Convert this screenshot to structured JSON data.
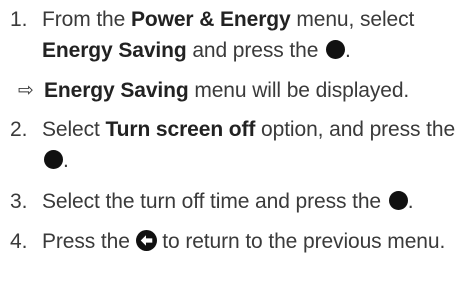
{
  "steps": [
    {
      "number": "1.",
      "parts": [
        "From the ",
        "Power & Energy",
        " menu, select ",
        "Energy Saving",
        " and press the ",
        "."
      ]
    },
    {
      "number": "2.",
      "parts": [
        "Select ",
        "Turn screen off",
        " option, and press the ",
        "."
      ]
    },
    {
      "number": "3.",
      "parts": [
        "Select the turn off time and press the ",
        "."
      ]
    },
    {
      "number": "4.",
      "parts": [
        "Press the ",
        " to return to the previous menu."
      ]
    }
  ],
  "result": {
    "arrow": "⇨",
    "bold": "Energy Saving",
    "rest": " menu will be displayed."
  },
  "icons": {
    "ok_button": "filled-circle-icon",
    "back_button": "back-arrow-circle-icon"
  }
}
